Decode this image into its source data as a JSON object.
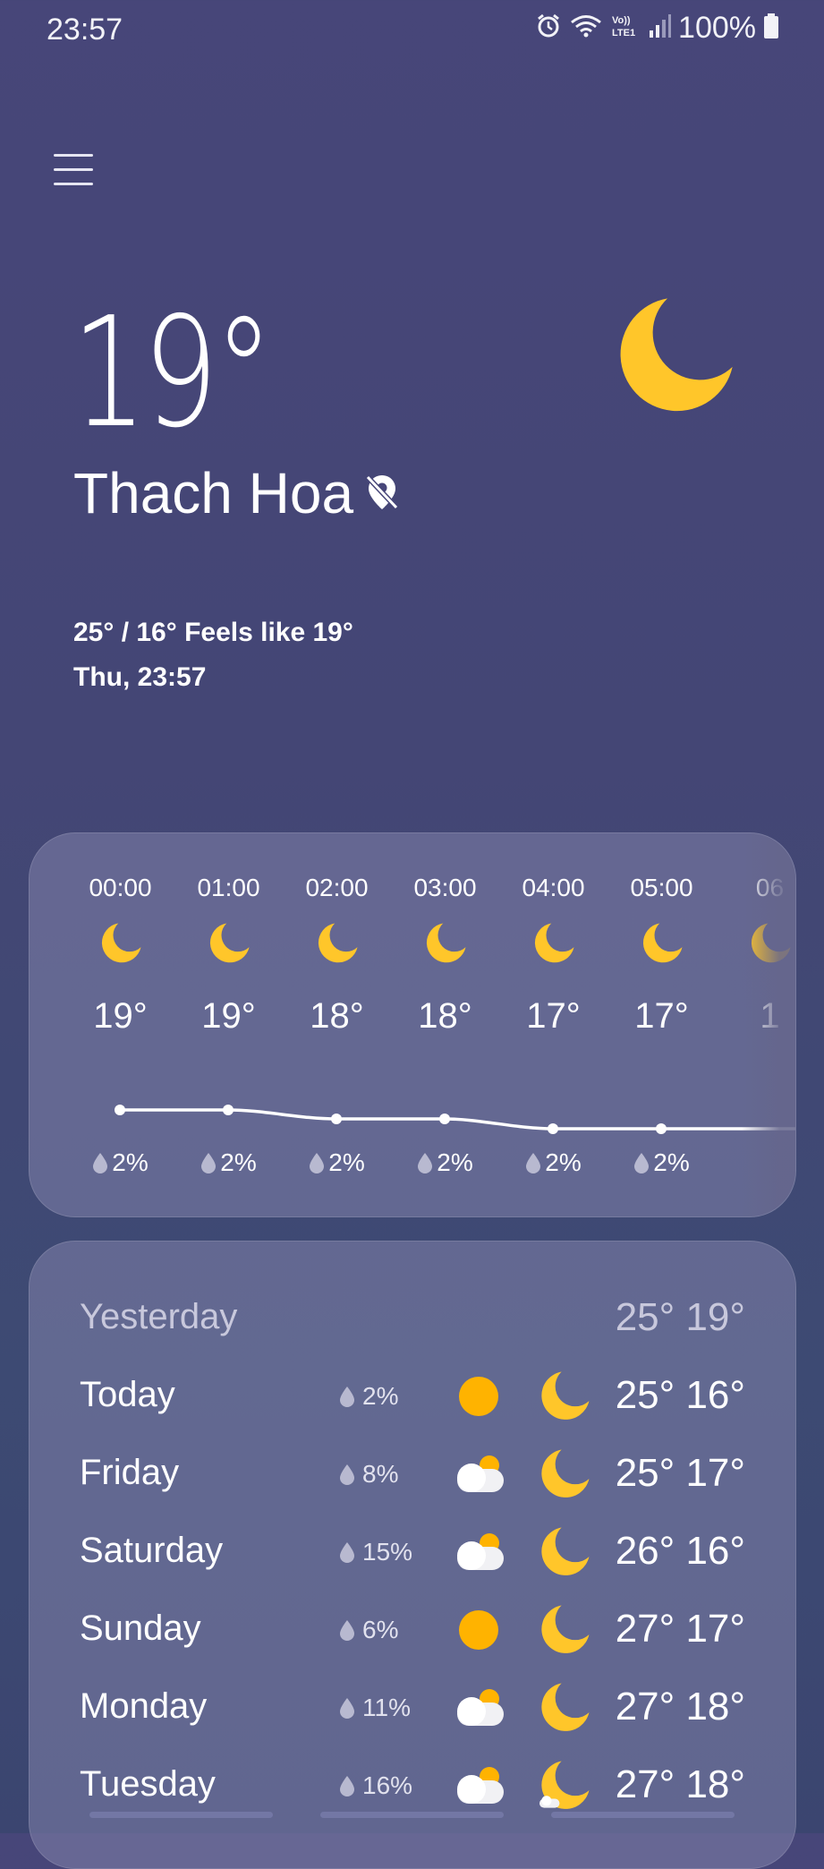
{
  "status_bar": {
    "time": "23:57",
    "battery": "100%",
    "icons": [
      "alarm-icon",
      "wifi-icon",
      "volte-icon",
      "signal-icon",
      "battery-icon"
    ]
  },
  "header": {
    "menu_icon": "hamburger-menu-icon",
    "current_temp": "19°",
    "condition_icon": "moon-icon",
    "location": "Thach Hoa",
    "location_icon": "location-off-icon",
    "hi_lo_feels": "25° / 16° Feels like 19°",
    "datetime": "Thu, 23:57"
  },
  "hourly": [
    {
      "time": "00:00",
      "icon": "moon-icon",
      "temp": "19°",
      "rain": "2%"
    },
    {
      "time": "01:00",
      "icon": "moon-icon",
      "temp": "19°",
      "rain": "2%"
    },
    {
      "time": "02:00",
      "icon": "moon-icon",
      "temp": "18°",
      "rain": "2%"
    },
    {
      "time": "03:00",
      "icon": "moon-icon",
      "temp": "18°",
      "rain": "2%"
    },
    {
      "time": "04:00",
      "icon": "moon-icon",
      "temp": "17°",
      "rain": "2%"
    },
    {
      "time": "05:00",
      "icon": "moon-icon",
      "temp": "17°",
      "rain": "2%"
    },
    {
      "time": "06",
      "icon": "moon-icon",
      "temp": "1",
      "rain": ""
    }
  ],
  "daily": [
    {
      "day": "Yesterday",
      "rain": "",
      "day_icon": "",
      "night_icon": "",
      "hilo": "25° 19°"
    },
    {
      "day": "Today",
      "rain": "2%",
      "day_icon": "sun-icon",
      "night_icon": "moon-icon",
      "hilo": "25° 16°"
    },
    {
      "day": "Friday",
      "rain": "8%",
      "day_icon": "partly-cloudy-icon",
      "night_icon": "moon-icon",
      "hilo": "25° 17°"
    },
    {
      "day": "Saturday",
      "rain": "15%",
      "day_icon": "partly-cloudy-icon",
      "night_icon": "moon-icon",
      "hilo": "26° 16°"
    },
    {
      "day": "Sunday",
      "rain": "6%",
      "day_icon": "sun-icon",
      "night_icon": "moon-icon",
      "hilo": "27° 17°"
    },
    {
      "day": "Monday",
      "rain": "11%",
      "day_icon": "partly-cloudy-icon",
      "night_icon": "moon-icon",
      "hilo": "27° 18°"
    },
    {
      "day": "Tuesday",
      "rain": "16%",
      "day_icon": "partly-cloudy-icon",
      "night_icon": "moon-cloud-icon",
      "hilo": "27° 18°"
    }
  ],
  "colors": {
    "moon": "#FFC62A",
    "sun": "#FFB300",
    "card": "#65668C",
    "background": "#454677"
  }
}
